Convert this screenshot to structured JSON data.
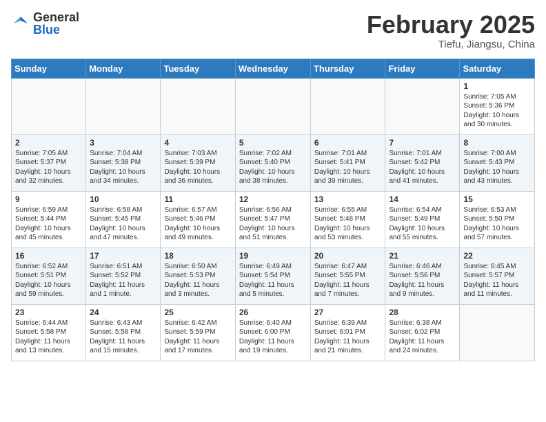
{
  "header": {
    "logo_general": "General",
    "logo_blue": "Blue",
    "month_title": "February 2025",
    "location": "Tiefu, Jiangsu, China"
  },
  "weekdays": [
    "Sunday",
    "Monday",
    "Tuesday",
    "Wednesday",
    "Thursday",
    "Friday",
    "Saturday"
  ],
  "weeks": [
    [
      {
        "day": "",
        "info": ""
      },
      {
        "day": "",
        "info": ""
      },
      {
        "day": "",
        "info": ""
      },
      {
        "day": "",
        "info": ""
      },
      {
        "day": "",
        "info": ""
      },
      {
        "day": "",
        "info": ""
      },
      {
        "day": "1",
        "info": "Sunrise: 7:05 AM\nSunset: 5:36 PM\nDaylight: 10 hours\nand 30 minutes."
      }
    ],
    [
      {
        "day": "2",
        "info": "Sunrise: 7:05 AM\nSunset: 5:37 PM\nDaylight: 10 hours\nand 32 minutes."
      },
      {
        "day": "3",
        "info": "Sunrise: 7:04 AM\nSunset: 5:38 PM\nDaylight: 10 hours\nand 34 minutes."
      },
      {
        "day": "4",
        "info": "Sunrise: 7:03 AM\nSunset: 5:39 PM\nDaylight: 10 hours\nand 36 minutes."
      },
      {
        "day": "5",
        "info": "Sunrise: 7:02 AM\nSunset: 5:40 PM\nDaylight: 10 hours\nand 38 minutes."
      },
      {
        "day": "6",
        "info": "Sunrise: 7:01 AM\nSunset: 5:41 PM\nDaylight: 10 hours\nand 39 minutes."
      },
      {
        "day": "7",
        "info": "Sunrise: 7:01 AM\nSunset: 5:42 PM\nDaylight: 10 hours\nand 41 minutes."
      },
      {
        "day": "8",
        "info": "Sunrise: 7:00 AM\nSunset: 5:43 PM\nDaylight: 10 hours\nand 43 minutes."
      }
    ],
    [
      {
        "day": "9",
        "info": "Sunrise: 6:59 AM\nSunset: 5:44 PM\nDaylight: 10 hours\nand 45 minutes."
      },
      {
        "day": "10",
        "info": "Sunrise: 6:58 AM\nSunset: 5:45 PM\nDaylight: 10 hours\nand 47 minutes."
      },
      {
        "day": "11",
        "info": "Sunrise: 6:57 AM\nSunset: 5:46 PM\nDaylight: 10 hours\nand 49 minutes."
      },
      {
        "day": "12",
        "info": "Sunrise: 6:56 AM\nSunset: 5:47 PM\nDaylight: 10 hours\nand 51 minutes."
      },
      {
        "day": "13",
        "info": "Sunrise: 6:55 AM\nSunset: 5:48 PM\nDaylight: 10 hours\nand 53 minutes."
      },
      {
        "day": "14",
        "info": "Sunrise: 6:54 AM\nSunset: 5:49 PM\nDaylight: 10 hours\nand 55 minutes."
      },
      {
        "day": "15",
        "info": "Sunrise: 6:53 AM\nSunset: 5:50 PM\nDaylight: 10 hours\nand 57 minutes."
      }
    ],
    [
      {
        "day": "16",
        "info": "Sunrise: 6:52 AM\nSunset: 5:51 PM\nDaylight: 10 hours\nand 59 minutes."
      },
      {
        "day": "17",
        "info": "Sunrise: 6:51 AM\nSunset: 5:52 PM\nDaylight: 11 hours\nand 1 minute."
      },
      {
        "day": "18",
        "info": "Sunrise: 6:50 AM\nSunset: 5:53 PM\nDaylight: 11 hours\nand 3 minutes."
      },
      {
        "day": "19",
        "info": "Sunrise: 6:49 AM\nSunset: 5:54 PM\nDaylight: 11 hours\nand 5 minutes."
      },
      {
        "day": "20",
        "info": "Sunrise: 6:47 AM\nSunset: 5:55 PM\nDaylight: 11 hours\nand 7 minutes."
      },
      {
        "day": "21",
        "info": "Sunrise: 6:46 AM\nSunset: 5:56 PM\nDaylight: 11 hours\nand 9 minutes."
      },
      {
        "day": "22",
        "info": "Sunrise: 6:45 AM\nSunset: 5:57 PM\nDaylight: 11 hours\nand 11 minutes."
      }
    ],
    [
      {
        "day": "23",
        "info": "Sunrise: 6:44 AM\nSunset: 5:58 PM\nDaylight: 11 hours\nand 13 minutes."
      },
      {
        "day": "24",
        "info": "Sunrise: 6:43 AM\nSunset: 5:58 PM\nDaylight: 11 hours\nand 15 minutes."
      },
      {
        "day": "25",
        "info": "Sunrise: 6:42 AM\nSunset: 5:59 PM\nDaylight: 11 hours\nand 17 minutes."
      },
      {
        "day": "26",
        "info": "Sunrise: 6:40 AM\nSunset: 6:00 PM\nDaylight: 11 hours\nand 19 minutes."
      },
      {
        "day": "27",
        "info": "Sunrise: 6:39 AM\nSunset: 6:01 PM\nDaylight: 11 hours\nand 21 minutes."
      },
      {
        "day": "28",
        "info": "Sunrise: 6:38 AM\nSunset: 6:02 PM\nDaylight: 11 hours\nand 24 minutes."
      },
      {
        "day": "",
        "info": ""
      }
    ]
  ]
}
